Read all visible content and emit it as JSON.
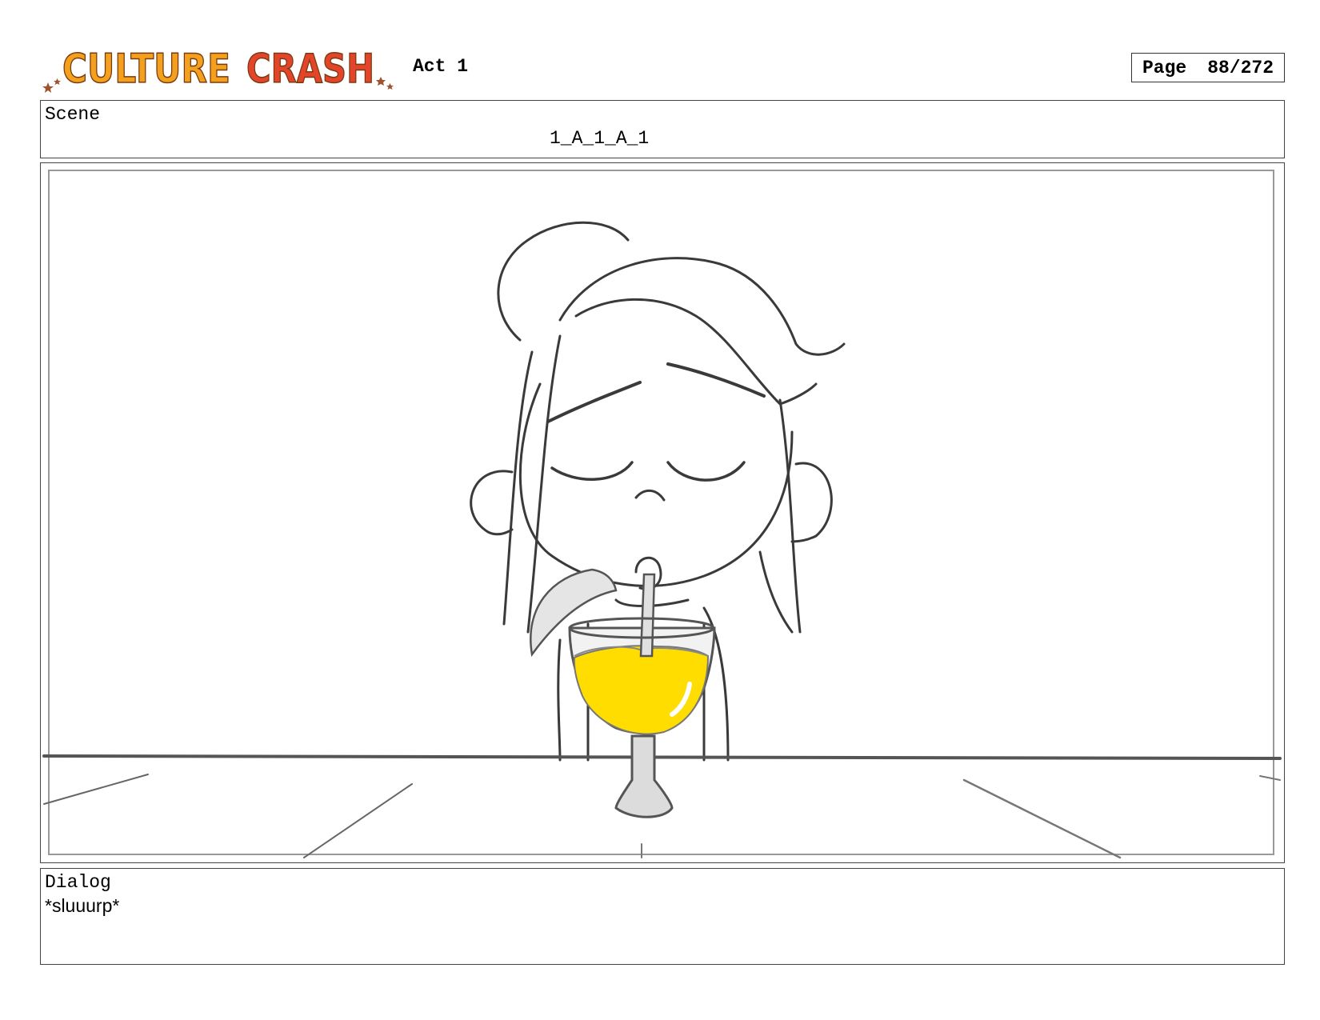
{
  "header": {
    "logo_text": "CULTURE CRASH",
    "act": "Act 1",
    "page_label": "Page",
    "page_number": "88/272"
  },
  "scene": {
    "label": "Scene",
    "id": "1_A_1_A_1"
  },
  "dialog": {
    "label": "Dialog",
    "text": "*sluuurp*"
  },
  "colors": {
    "logo_orange": "#F2A01E",
    "logo_red": "#E2452A",
    "drink_yellow": "#FFDD00",
    "sketch_line": "#3a3a3a"
  }
}
